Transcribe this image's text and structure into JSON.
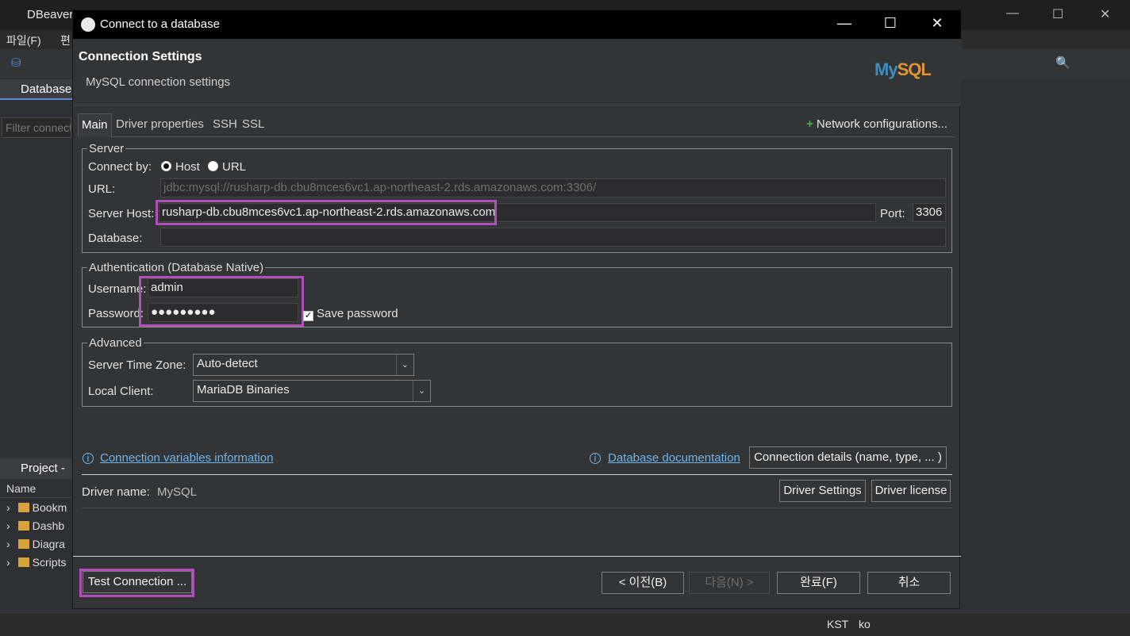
{
  "app": {
    "title": "DBeaver",
    "menu": [
      "파일(F)",
      "편"
    ],
    "db_tab": "Database",
    "filter_placeholder": "Filter connect",
    "project_tab": "Project - ",
    "name_col": "Name",
    "tree": [
      "Bookm",
      "Dashb",
      "Diagra",
      "Scripts"
    ],
    "status": {
      "tz": "KST",
      "lang": "ko"
    }
  },
  "dialog": {
    "title": "Connect to a database",
    "header_title": "Connection Settings",
    "header_subtitle": "MySQL connection settings",
    "logo_text_a": "My",
    "logo_text_b": "SQL",
    "tabs": [
      "Main",
      "Driver properties",
      "SSH",
      "SSL"
    ],
    "network_config": "Network configurations...",
    "server": {
      "legend": "Server",
      "connect_by_label": "Connect by:",
      "host_option": "Host",
      "url_option": "URL",
      "url_label": "URL:",
      "url_value": "jdbc:mysql://rusharp-db.cbu8mces6vc1.ap-northeast-2.rds.amazonaws.com:3306/",
      "host_label": "Server Host:",
      "host_value": "rusharp-db.cbu8mces6vc1.ap-northeast-2.rds.amazonaws.com",
      "port_label": "Port:",
      "port_value": "3306",
      "database_label": "Database:",
      "database_value": ""
    },
    "auth": {
      "legend": "Authentication (Database Native)",
      "username_label": "Username:",
      "username_value": "admin",
      "password_label": "Password:",
      "password_value": "●●●●●●●●●",
      "save_password_label": "Save password",
      "save_password_checked": true
    },
    "advanced": {
      "legend": "Advanced",
      "timezone_label": "Server Time Zone:",
      "timezone_value": "Auto-detect",
      "client_label": "Local Client:",
      "client_value": "MariaDB Binaries"
    },
    "conn_vars_link": "Connection variables information",
    "db_doc_link": "Database documentation",
    "conn_details_button": "Connection details (name, type, ... )",
    "driver_name_label": "Driver name:",
    "driver_name_value": "MySQL",
    "driver_settings_button": "Driver Settings",
    "driver_license_button": "Driver license",
    "test_connection_button": "Test Connection ...",
    "prev_button": "< 이전(B)",
    "next_button": "다음(N) >",
    "finish_button": "완료(F)",
    "cancel_button": "취소",
    "highlight_color": "#b04fb8"
  }
}
